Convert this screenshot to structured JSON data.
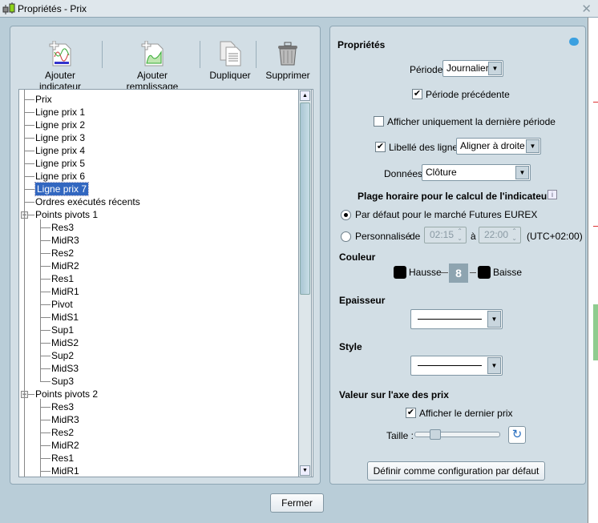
{
  "window": {
    "title": "Propriétés - Prix",
    "close": "✕"
  },
  "toolbar": {
    "add_indicator": "Ajouter indicateur",
    "add_fill": "Ajouter remplissage",
    "duplicate": "Dupliquer",
    "delete": "Supprimer"
  },
  "tree": {
    "top": [
      "Prix",
      "Ligne prix 1",
      "Ligne prix 2",
      "Ligne prix 3",
      "Ligne prix 4",
      "Ligne prix 5",
      "Ligne prix 6",
      "Ligne prix 7",
      "Ordres exécutés récents"
    ],
    "selected": "Ligne prix 7",
    "pivots1": {
      "label": "Points pivots 1",
      "children": [
        "Res3",
        "MidR3",
        "Res2",
        "MidR2",
        "Res1",
        "MidR1",
        "Pivot",
        "MidS1",
        "Sup1",
        "MidS2",
        "Sup2",
        "MidS3",
        "Sup3"
      ]
    },
    "pivots2": {
      "label": "Points pivots 2",
      "children": [
        "Res3",
        "MidR3",
        "Res2",
        "MidR2",
        "Res1",
        "MidR1"
      ]
    }
  },
  "props": {
    "heading": "Propriétés",
    "period_label": "Période",
    "period_value": "Journalier",
    "prev_period": "Période précédente",
    "prev_period_checked": true,
    "last_period_only": "Afficher uniquement la dernière période",
    "last_period_only_checked": false,
    "line_labels": "Libellé des lignes",
    "line_labels_checked": true,
    "line_labels_align": "Aligner à droite",
    "data_label": "Données",
    "data_value": "Clôture",
    "time_range_heading": "Plage horaire pour le calcul de l'indicateur",
    "default_market": "Par défaut pour le marché Futures EUREX",
    "custom": "Personnalisé",
    "from": "de",
    "from_time": "02:15",
    "to": "à",
    "to_time": "22:00",
    "tz": "(UTC+02:00)",
    "color_heading": "Couleur",
    "up": "Hausse",
    "down": "Baisse",
    "up_color": "#000000",
    "down_color": "#000000",
    "thickness_heading": "Epaisseur",
    "style_heading": "Style",
    "price_axis_heading": "Valeur sur l'axe des prix",
    "show_last_price": "Afficher le dernier prix",
    "show_last_price_checked": true,
    "size_label": "Taille :",
    "size_value": 0.2,
    "set_default": "Définir comme configuration par défaut"
  },
  "footer": {
    "close": "Fermer"
  }
}
